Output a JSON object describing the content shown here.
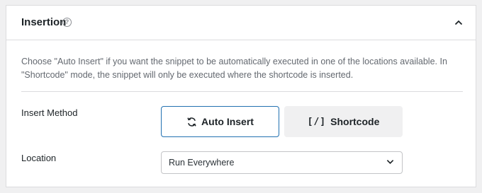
{
  "panel": {
    "title": "Insertion",
    "help_icon": "question-circle-icon",
    "collapse_icon": "chevron-up-icon",
    "description": "Choose \"Auto Insert\" if you want the snippet to be automatically executed in one of the locations available. In \"Shortcode\" mode, the snippet will only be executed where the shortcode is inserted."
  },
  "insert_method": {
    "label": "Insert Method",
    "options": [
      {
        "label": "Auto Insert",
        "icon": "refresh-icon",
        "selected": true
      },
      {
        "label": "Shortcode",
        "icon": "shortcode-icon",
        "glyph": "[/]",
        "selected": false
      }
    ]
  },
  "location": {
    "label": "Location",
    "selected": "Run Everywhere",
    "icon": "chevron-down-icon"
  },
  "colors": {
    "accent": "#2271b1",
    "border": "#dcdcde",
    "muted_text": "#646970",
    "background": "#f0f0f1"
  }
}
